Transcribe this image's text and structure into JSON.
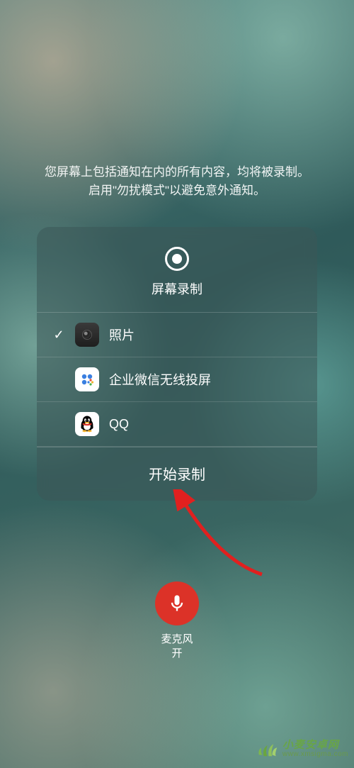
{
  "hint": {
    "line1": "您屏幕上包括通知在内的所有内容，均将被录制。",
    "line2": "启用\"勿扰模式\"以避免意外通知。"
  },
  "card": {
    "title": "屏幕录制",
    "options": [
      {
        "label": "照片",
        "selected": true,
        "icon": "photos"
      },
      {
        "label": "企业微信无线投屏",
        "selected": false,
        "icon": "wework"
      },
      {
        "label": "QQ",
        "selected": false,
        "icon": "qq"
      }
    ],
    "start": "开始录制"
  },
  "mic": {
    "label_line1": "麦克风",
    "label_line2": "开",
    "on": true,
    "color": "#dc3228"
  },
  "watermark": {
    "name": "小麦安卓网",
    "domain": "www.xmsigma.com"
  }
}
